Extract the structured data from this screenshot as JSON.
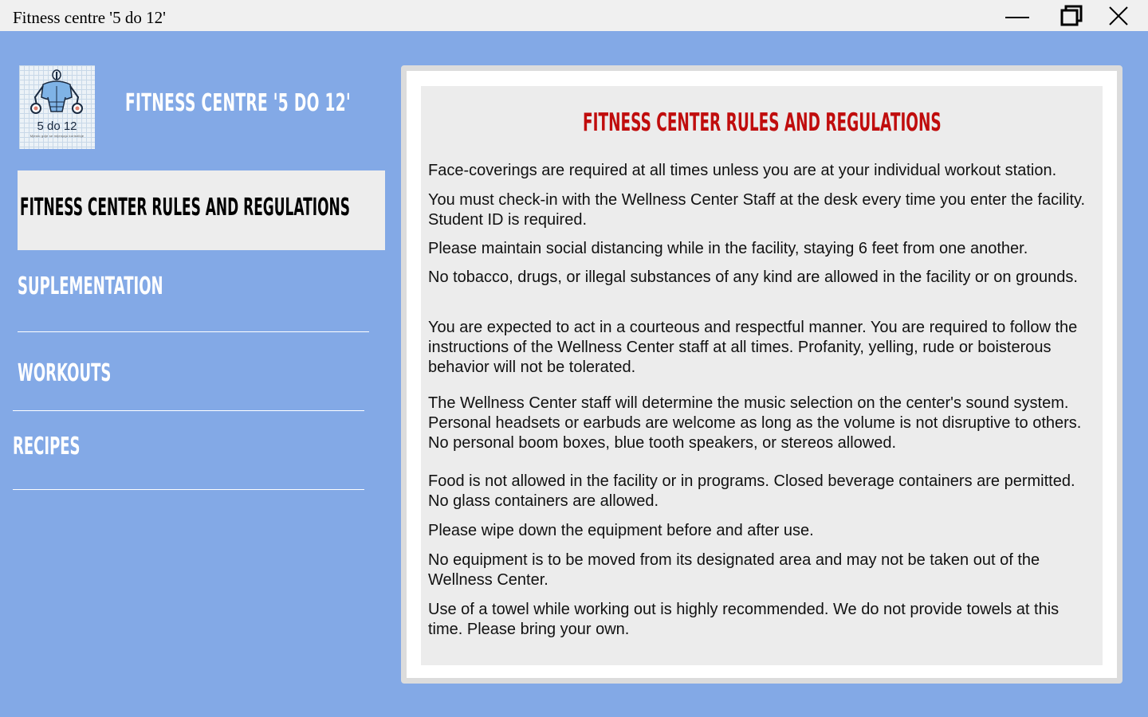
{
  "window": {
    "title": "Fitness centre '5 do 12'",
    "controls": [
      "minimize-icon",
      "restore-icon",
      "close-icon"
    ]
  },
  "logo": {
    "text": "5 do 12",
    "subtext": "Mjesto gdje se mijenjaju korisnikje"
  },
  "app_title": "FITNESS CENTRE '5 DO 12'",
  "nav": [
    {
      "label": "FITNESS CENTER RULES AND REGULATIONS",
      "active": true
    },
    {
      "label": "SUPLEMENTATION",
      "active": false
    },
    {
      "label": "WORKOUTS",
      "active": false
    },
    {
      "label": "RECIPES",
      "active": false
    }
  ],
  "content": {
    "heading": "FITNESS CENTER RULES AND REGULATIONS",
    "rules": [
      "Face-coverings are required at all times unless you are at your individual workout station.",
      "You must check-in with the Wellness Center Staff at the desk every time you enter the facility. Student ID is required.",
      "Please maintain social distancing while in the facility, staying 6 feet from one another.",
      "No tobacco, drugs, or illegal substances of any kind are allowed in the facility or on grounds.",
      "You are expected to act in a courteous and respectful manner. You are required to follow the instructions of the Wellness Center staff at all times. Profanity, yelling, rude or boisterous behavior will not be tolerated.",
      "The Wellness Center staff will determine the music selection on the center's sound system. Personal headsets or earbuds are welcome as long as the volume is not disruptive to others. No personal boom boxes, blue tooth speakers, or stereos allowed.",
      "Food is not allowed in the facility or in programs. Closed beverage containers are permitted. No glass containers are allowed.",
      "Please wipe down the equipment before and after use.",
      "No equipment is to be moved from its designated area and may not be taken out of the Wellness Center.",
      "Use of a towel while working out is highly recommended. We do not provide towels at this time. Please bring your own."
    ]
  },
  "colors": {
    "background": "#83a9e6",
    "heading": "#c00d0d",
    "panel": "#ececec",
    "active_nav": "#ededed"
  }
}
